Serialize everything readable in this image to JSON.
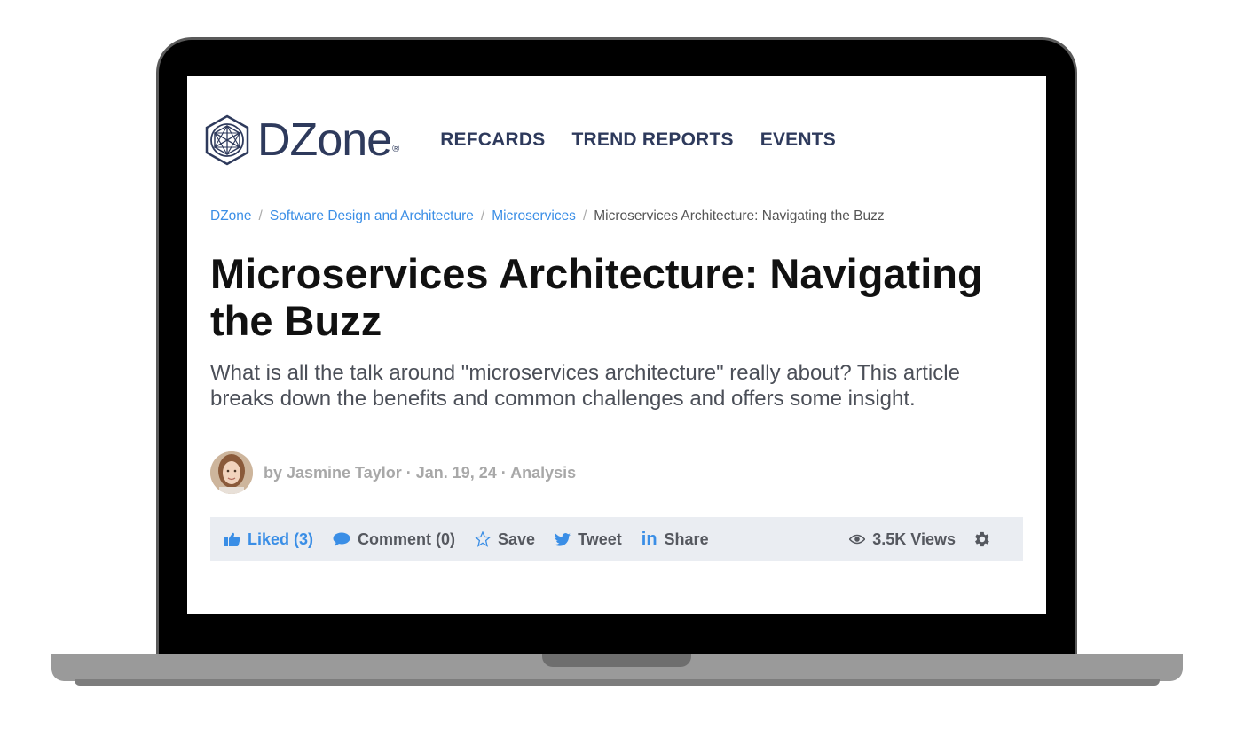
{
  "header": {
    "logo_text": "DZone",
    "logo_reg": "®",
    "nav": [
      "REFCARDS",
      "TREND REPORTS",
      "EVENTS"
    ]
  },
  "breadcrumb": {
    "links": [
      "DZone",
      "Software Design and Architecture",
      "Microservices"
    ],
    "separator": "/",
    "current": "Microservices Architecture: Navigating the Buzz"
  },
  "article": {
    "title": "Microservices Architecture: Navigating the Buzz",
    "subtitle": "What is all the talk around \"microservices architecture\" really about? This article breaks down the benefits and common challenges and offers some insight.",
    "byline": "by Jasmine Taylor · Jan. 19, 24 · Analysis"
  },
  "actions": {
    "liked": "Liked (3)",
    "comment": "Comment (0)",
    "save": "Save",
    "tweet": "Tweet",
    "share": "Share",
    "views": "3.5K Views"
  },
  "colors": {
    "accent": "#3a8ee6",
    "brand": "#2e3a5c",
    "action_bar": "#eaedf2"
  },
  "icons": [
    "dzone-logo-icon",
    "thumbs-up-icon",
    "comment-icon",
    "star-icon",
    "twitter-icon",
    "linkedin-icon",
    "eye-icon",
    "gear-icon"
  ]
}
